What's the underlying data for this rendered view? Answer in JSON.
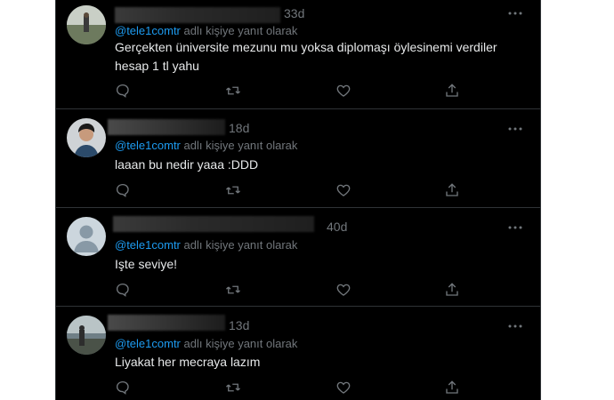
{
  "tweets": [
    {
      "time": "33d",
      "handle": "@tele1comtr",
      "reply_suffix": " adlı kişiye yanıt olarak",
      "text": "Gerçekten üniversite mezunu mu yoksa diplomaşı öylesinemi verdiler hesap 1 tl yahu",
      "avatar": "photo-outdoor-person"
    },
    {
      "time": "18d",
      "handle": "@tele1comtr",
      "reply_suffix": " adlı kişiye yanıt olarak",
      "text": "laaan bu nedir yaaa :DDD",
      "avatar": "photo-young-man"
    },
    {
      "time": "40d",
      "handle": "@tele1comtr",
      "reply_suffix": " adlı kişiye yanıt olarak",
      "text": "Işte seviye!",
      "avatar": "default-profile"
    },
    {
      "time": "13d",
      "handle": "@tele1comtr",
      "reply_suffix": " adlı kişiye yanıt olarak",
      "text": "Liyakat her mecraya lazım",
      "avatar": "photo-landscape"
    }
  ],
  "icons": {
    "more": "more-horizontal-icon",
    "reply": "reply-icon",
    "retweet": "retweet-icon",
    "like": "heart-icon",
    "share": "share-icon"
  },
  "colors": {
    "background": "#000000",
    "text": "#e7e9ea",
    "muted": "#71767b",
    "link": "#1d9bf0",
    "border": "#2f3336"
  }
}
